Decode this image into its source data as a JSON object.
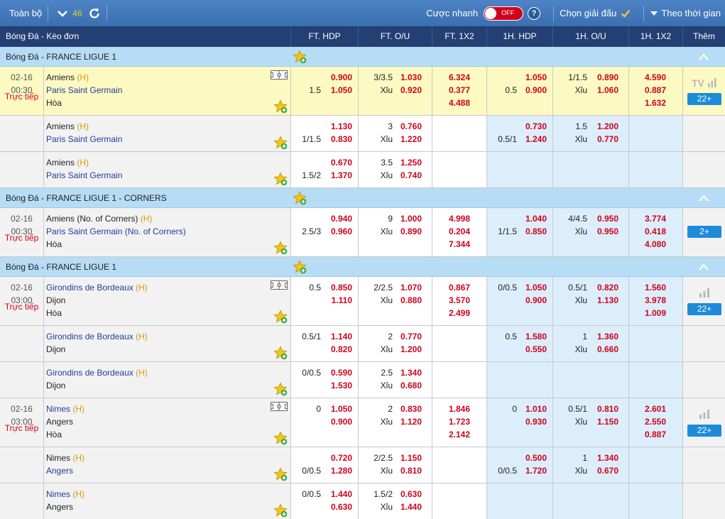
{
  "toolbar": {
    "all_label": "Toàn bộ",
    "count": "46",
    "quick_label": "Cược nhanh",
    "toggle_state": "OFF",
    "help_label": "?",
    "league_select_label": "Chọn giải đấu",
    "time_sort_label": "Theo thời gian"
  },
  "columns": {
    "sport": "Bóng Đá - Kèo đơn",
    "ft_hdp": "FT. HDP",
    "ft_ou": "FT. O/U",
    "ft_1x2": "FT. 1X2",
    "h1_hdp": "1H. HDP",
    "h1_ou": "1H. O/U",
    "h1_1x2": "1H. 1X2",
    "more": "Thêm"
  },
  "labels": {
    "live": "Trực tiếp",
    "under": "Xỉu",
    "home_tag": "(H)"
  },
  "colors": {
    "header": "#243f73",
    "toolbar": "#3a6fb0",
    "league_band": "#b7dcf5",
    "odds_red": "#d0021b",
    "team_blue": "#1f3d99",
    "home_gold": "#d99a00",
    "more_button": "#1e8bd9"
  },
  "sections": [
    {
      "league": "Bóng Đá - FRANCE LIGUE 1",
      "rows": [
        {
          "h": 69,
          "hl": true,
          "date": "02-16",
          "time": "00:30",
          "live": true,
          "field": true,
          "fav": [
            false,
            true
          ],
          "teams": [
            {
              "name": "Amiens",
              "home": true
            },
            {
              "name": "Paris Saint Germain",
              "home": false
            },
            {
              "name": "Hòa",
              "home": false
            }
          ],
          "ft_hdp": [
            [
              "",
              "0.900"
            ],
            [
              "1.5",
              "1.050"
            ]
          ],
          "ft_ou": [
            [
              "3/3.5",
              "1.030"
            ],
            [
              "Xỉu",
              "0.920"
            ]
          ],
          "ft_1x2": [
            "6.324",
            "0.377",
            "4.488"
          ],
          "h1_hdp": [
            [
              "",
              "1.050"
            ],
            [
              "0.5",
              "0.900"
            ]
          ],
          "h1_ou": [
            [
              "1/1.5",
              "0.890"
            ],
            [
              "Xỉu",
              "1.060"
            ]
          ],
          "h1_1x2": [
            "4.590",
            "0.887",
            "1.632"
          ],
          "more": "22+",
          "media": "tv"
        },
        {
          "h": 51,
          "hl": false,
          "fav": [
            false,
            true
          ],
          "teams": [
            {
              "name": "Amiens",
              "home": true
            },
            {
              "name": "Paris Saint Germain",
              "home": false
            }
          ],
          "ft_hdp": [
            [
              "",
              "1.130"
            ],
            [
              "1/1.5",
              "0.830"
            ]
          ],
          "ft_ou": [
            [
              "3",
              "0.760"
            ],
            [
              "Xỉu",
              "1.220"
            ]
          ],
          "ft_1x2": [],
          "h1_hdp": [
            [
              "",
              "0.730"
            ],
            [
              "0.5/1",
              "1.240"
            ]
          ],
          "h1_ou": [
            [
              "1.5",
              "1.200"
            ],
            [
              "Xỉu",
              "0.770"
            ]
          ],
          "h1_1x2": []
        },
        {
          "h": 51,
          "hl": false,
          "fav": [
            false,
            true
          ],
          "teams": [
            {
              "name": "Amiens",
              "home": true
            },
            {
              "name": "Paris Saint Germain",
              "home": false
            }
          ],
          "ft_hdp": [
            [
              "",
              "0.670"
            ],
            [
              "1.5/2",
              "1.370"
            ]
          ],
          "ft_ou": [
            [
              "3.5",
              "1.250"
            ],
            [
              "Xỉu",
              "0.740"
            ]
          ],
          "ft_1x2": [],
          "h1_hdp": [],
          "h1_ou": [],
          "h1_1x2": []
        }
      ]
    },
    {
      "league": "Bóng Đá - FRANCE LIGUE 1 - CORNERS",
      "rows": [
        {
          "h": 69,
          "hl": false,
          "date": "02-16",
          "time": "00:30",
          "live": true,
          "field": false,
          "fav": [
            false,
            true
          ],
          "teams": [
            {
              "name": "Amiens (No. of Corners)",
              "home": true
            },
            {
              "name": "Paris Saint Germain (No. of Corners)",
              "home": false
            },
            {
              "name": "Hòa",
              "home": false
            }
          ],
          "ft_hdp": [
            [
              "",
              "0.940"
            ],
            [
              "2.5/3",
              "0.960"
            ]
          ],
          "ft_ou": [
            [
              "9",
              "1.000"
            ],
            [
              "Xỉu",
              "0.890"
            ]
          ],
          "ft_1x2": [
            "4.998",
            "0.204",
            "7.344"
          ],
          "h1_hdp": [
            [
              "",
              "1.040"
            ],
            [
              "1/1.5",
              "0.850"
            ]
          ],
          "h1_ou": [
            [
              "4/4.5",
              "0.950"
            ],
            [
              "Xỉu",
              "0.950"
            ]
          ],
          "h1_1x2": [
            "3.774",
            "0.418",
            "4.080"
          ],
          "more": "2+",
          "media": ""
        }
      ]
    },
    {
      "league": "Bóng Đá - FRANCE LIGUE 1",
      "rows": [
        {
          "h": 69,
          "hl": false,
          "date": "02-16",
          "time": "03:00",
          "live": true,
          "field": true,
          "fav": [
            true,
            false
          ],
          "teams": [
            {
              "name": "Girondins de Bordeaux",
              "home": true
            },
            {
              "name": "Dijon",
              "home": false
            },
            {
              "name": "Hòa",
              "home": false
            }
          ],
          "ft_hdp": [
            [
              "0.5",
              "0.850"
            ],
            [
              "",
              "1.110"
            ]
          ],
          "ft_ou": [
            [
              "2/2.5",
              "1.070"
            ],
            [
              "Xỉu",
              "0.880"
            ]
          ],
          "ft_1x2": [
            "0.867",
            "3.570",
            "2.499"
          ],
          "h1_hdp": [
            [
              "0/0.5",
              "1.050"
            ],
            [
              "",
              "0.900"
            ]
          ],
          "h1_ou": [
            [
              "0.5/1",
              "0.820"
            ],
            [
              "Xỉu",
              "1.130"
            ]
          ],
          "h1_1x2": [
            "1.560",
            "3.978",
            "1.009"
          ],
          "more": "22+",
          "media": "bars"
        },
        {
          "h": 51,
          "hl": false,
          "fav": [
            true,
            false
          ],
          "teams": [
            {
              "name": "Girondins de Bordeaux",
              "home": true
            },
            {
              "name": "Dijon",
              "home": false
            }
          ],
          "ft_hdp": [
            [
              "0.5/1",
              "1.140"
            ],
            [
              "",
              "0.820"
            ]
          ],
          "ft_ou": [
            [
              "2",
              "0.770"
            ],
            [
              "Xỉu",
              "1.200"
            ]
          ],
          "ft_1x2": [],
          "h1_hdp": [
            [
              "0.5",
              "1.580"
            ],
            [
              "",
              "0.550"
            ]
          ],
          "h1_ou": [
            [
              "1",
              "1.360"
            ],
            [
              "Xỉu",
              "0.660"
            ]
          ],
          "h1_1x2": []
        },
        {
          "h": 51,
          "hl": false,
          "fav": [
            true,
            false
          ],
          "teams": [
            {
              "name": "Girondins de Bordeaux",
              "home": true
            },
            {
              "name": "Dijon",
              "home": false
            }
          ],
          "ft_hdp": [
            [
              "0/0.5",
              "0.590"
            ],
            [
              "",
              "1.530"
            ]
          ],
          "ft_ou": [
            [
              "2.5",
              "1.340"
            ],
            [
              "Xỉu",
              "0.680"
            ]
          ],
          "ft_1x2": [],
          "h1_hdp": [],
          "h1_ou": [],
          "h1_1x2": []
        },
        {
          "h": 69,
          "hl": false,
          "date": "02-16",
          "time": "03:00",
          "live": true,
          "field": true,
          "fav": [
            true,
            false
          ],
          "teams": [
            {
              "name": "Nimes",
              "home": true
            },
            {
              "name": "Angers",
              "home": false
            },
            {
              "name": "Hòa",
              "home": false
            }
          ],
          "ft_hdp": [
            [
              "0",
              "1.050"
            ],
            [
              "",
              "0.900"
            ]
          ],
          "ft_ou": [
            [
              "2",
              "0.830"
            ],
            [
              "Xỉu",
              "1.120"
            ]
          ],
          "ft_1x2": [
            "1.846",
            "1.723",
            "2.142"
          ],
          "h1_hdp": [
            [
              "0",
              "1.010"
            ],
            [
              "",
              "0.930"
            ]
          ],
          "h1_ou": [
            [
              "0.5/1",
              "0.810"
            ],
            [
              "Xỉu",
              "1.150"
            ]
          ],
          "h1_1x2": [
            "2.601",
            "2.550",
            "0.887"
          ],
          "more": "22+",
          "media": "bars"
        },
        {
          "h": 51,
          "hl": false,
          "fav": [
            false,
            true
          ],
          "teams": [
            {
              "name": "Nimes",
              "home": true
            },
            {
              "name": "Angers",
              "home": false
            }
          ],
          "ft_hdp": [
            [
              "",
              "0.720"
            ],
            [
              "0/0.5",
              "1.280"
            ]
          ],
          "ft_ou": [
            [
              "2/2.5",
              "1.150"
            ],
            [
              "Xỉu",
              "0.810"
            ]
          ],
          "ft_1x2": [],
          "h1_hdp": [
            [
              "",
              "0.500"
            ],
            [
              "0/0.5",
              "1.720"
            ]
          ],
          "h1_ou": [
            [
              "1",
              "1.340"
            ],
            [
              "Xỉu",
              "0.670"
            ]
          ],
          "h1_1x2": []
        },
        {
          "h": 51,
          "hl": false,
          "fav": [
            true,
            false
          ],
          "teams": [
            {
              "name": "Nimes",
              "home": true
            },
            {
              "name": "Angers",
              "home": false
            }
          ],
          "ft_hdp": [
            [
              "0/0.5",
              "1.440"
            ],
            [
              "",
              "0.630"
            ]
          ],
          "ft_ou": [
            [
              "1.5/2",
              "0.630"
            ],
            [
              "Xỉu",
              "1.440"
            ]
          ],
          "ft_1x2": [],
          "h1_hdp": [],
          "h1_ou": [],
          "h1_1x2": []
        }
      ]
    }
  ]
}
